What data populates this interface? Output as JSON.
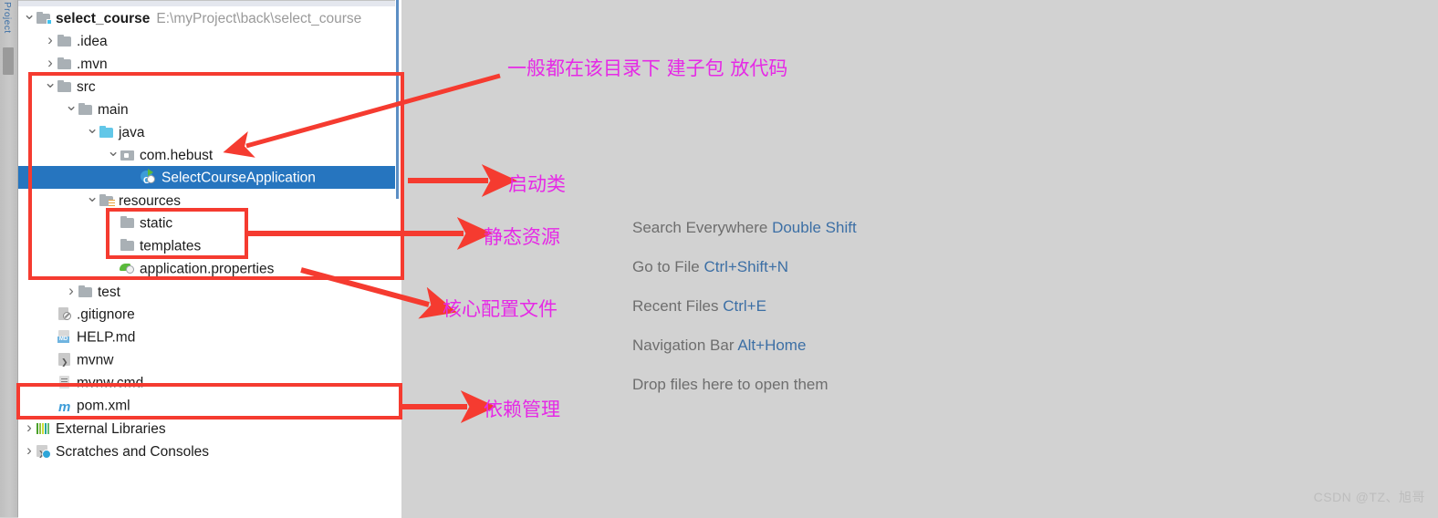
{
  "toolstrip": {
    "vertical_tab": "Project"
  },
  "project_tree": {
    "rows": [
      {
        "indent": 0,
        "chevron": "down",
        "icon": "folder-module-icon",
        "label": "select_course",
        "bold": true,
        "path": "E:\\myProject\\back\\select_course",
        "selected": false
      },
      {
        "indent": 1,
        "chevron": "right",
        "icon": "folder-icon",
        "label": ".idea",
        "bold": false,
        "path": "",
        "selected": false
      },
      {
        "indent": 1,
        "chevron": "right",
        "icon": "folder-icon",
        "label": ".mvn",
        "bold": false,
        "path": "",
        "selected": false
      },
      {
        "indent": 1,
        "chevron": "down",
        "icon": "folder-icon",
        "label": "src",
        "bold": false,
        "path": "",
        "selected": false
      },
      {
        "indent": 2,
        "chevron": "down",
        "icon": "folder-icon",
        "label": "main",
        "bold": false,
        "path": "",
        "selected": false
      },
      {
        "indent": 3,
        "chevron": "down",
        "icon": "folder-sources-icon",
        "label": "java",
        "bold": false,
        "path": "",
        "selected": false
      },
      {
        "indent": 4,
        "chevron": "down",
        "icon": "package-icon",
        "label": "com.hebust",
        "bold": false,
        "path": "",
        "selected": false
      },
      {
        "indent": 5,
        "chevron": "none",
        "icon": "spring-class-icon",
        "label": "SelectCourseApplication",
        "bold": false,
        "path": "",
        "selected": true
      },
      {
        "indent": 3,
        "chevron": "down",
        "icon": "folder-resources-icon",
        "label": "resources",
        "bold": false,
        "path": "",
        "selected": false
      },
      {
        "indent": 4,
        "chevron": "none",
        "icon": "folder-icon",
        "label": "static",
        "bold": false,
        "path": "",
        "selected": false
      },
      {
        "indent": 4,
        "chevron": "none",
        "icon": "folder-icon",
        "label": "templates",
        "bold": false,
        "path": "",
        "selected": false
      },
      {
        "indent": 4,
        "chevron": "none",
        "icon": "properties-icon",
        "label": "application.properties",
        "bold": false,
        "path": "",
        "selected": false
      },
      {
        "indent": 2,
        "chevron": "right",
        "icon": "folder-icon",
        "label": "test",
        "bold": false,
        "path": "",
        "selected": false
      },
      {
        "indent": 1,
        "chevron": "none",
        "icon": "gitignore-icon",
        "label": ".gitignore",
        "bold": false,
        "path": "",
        "selected": false
      },
      {
        "indent": 1,
        "chevron": "none",
        "icon": "markdown-icon",
        "label": "HELP.md",
        "bold": false,
        "path": "",
        "selected": false
      },
      {
        "indent": 1,
        "chevron": "none",
        "icon": "script-icon",
        "label": "mvnw",
        "bold": false,
        "path": "",
        "selected": false
      },
      {
        "indent": 1,
        "chevron": "none",
        "icon": "cmd-file-icon",
        "label": "mvnw.cmd",
        "bold": false,
        "path": "",
        "selected": false
      },
      {
        "indent": 1,
        "chevron": "none",
        "icon": "maven-icon",
        "label": "pom.xml",
        "bold": false,
        "path": "",
        "selected": false
      },
      {
        "indent": 0,
        "chevron": "right",
        "icon": "external-libraries-icon",
        "label": "External Libraries",
        "bold": false,
        "path": "",
        "selected": false
      },
      {
        "indent": 0,
        "chevron": "right",
        "icon": "scratches-icon",
        "label": "Scratches and Consoles",
        "bold": false,
        "path": "",
        "selected": false
      }
    ]
  },
  "editor_hints": [
    {
      "text": "Search Everywhere",
      "shortcut": "Double Shift"
    },
    {
      "text": "Go to File",
      "shortcut": "Ctrl+Shift+N"
    },
    {
      "text": "Recent Files",
      "shortcut": "Ctrl+E"
    },
    {
      "text": "Navigation Bar",
      "shortcut": "Alt+Home"
    },
    {
      "text": "Drop files here to open them",
      "shortcut": ""
    }
  ],
  "annotations": [
    {
      "id": "src-note",
      "text": "一般都在该目录下  建子包  放代码"
    },
    {
      "id": "main-class-note",
      "text": "启动类"
    },
    {
      "id": "static-note",
      "text": "静态资源"
    },
    {
      "id": "config-note",
      "text": "核心配置文件"
    },
    {
      "id": "dependency-note",
      "text": "依赖管理"
    }
  ],
  "watermark": {
    "text": "CSDN @TZ、旭哥"
  },
  "colors": {
    "annotation": "#e629e6",
    "arrow": "#f53b30",
    "selection": "#2675bf",
    "hint_key": "#3c6fa5",
    "editor_bg": "#d2d2d2"
  }
}
